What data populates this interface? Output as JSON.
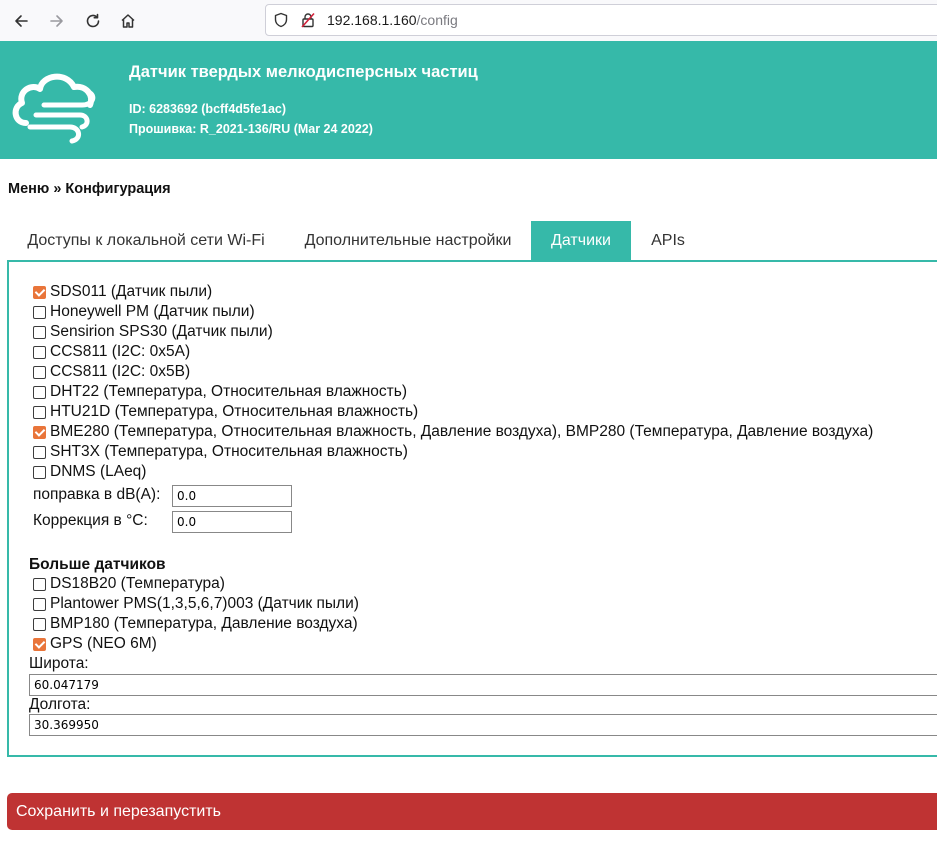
{
  "browser": {
    "url_host": "192.168.1.160",
    "url_path": "/config"
  },
  "header": {
    "title": "Датчик твердых мелкодисперсных частиц",
    "id_line": "ID: 6283692 (bcff4d5fe1ac)",
    "firmware_line": "Прошивка: R_2021-136/RU (Mar 24 2022)",
    "brand_color": "#36b9a9"
  },
  "breadcrumb": "Меню » Конфигурация",
  "tabs": [
    {
      "label": "Доступы к локальной сети Wi-Fi",
      "active": false
    },
    {
      "label": "Дополнительные настройки",
      "active": false
    },
    {
      "label": "Датчики",
      "active": true
    },
    {
      "label": "APIs",
      "active": false
    }
  ],
  "sensors": [
    {
      "label": "SDS011 (Датчик пыли)",
      "checked": true
    },
    {
      "label": "Honeywell PM (Датчик пыли)",
      "checked": false
    },
    {
      "label": "Sensirion SPS30 (Датчик пыли)",
      "checked": false
    },
    {
      "label": "CCS811 (I2C: 0x5A)",
      "checked": false
    },
    {
      "label": "CCS811 (I2C: 0x5B)",
      "checked": false
    },
    {
      "label": "DHT22 (Температура, Относительная влажность)",
      "checked": false
    },
    {
      "label": "HTU21D (Температура, Относительная влажность)",
      "checked": false
    },
    {
      "label": "BME280 (Температура, Относительная влажность, Давление воздуха), BMP280 (Температура, Давление воздуха)",
      "checked": true
    },
    {
      "label": "SHT3X (Температура, Относительная влажность)",
      "checked": false
    },
    {
      "label": "DNMS (LAeq)",
      "checked": false
    }
  ],
  "corrections": {
    "dba_label": "поправка в dB(A):",
    "dba_value": "0.0",
    "temp_label": "Коррекция в °C:",
    "temp_value": "0.0"
  },
  "more": {
    "title": "Больше датчиков",
    "items": [
      {
        "label": "DS18B20 (Температура)",
        "checked": false
      },
      {
        "label": "Plantower PMS(1,3,5,6,7)003 (Датчик пыли)",
        "checked": false
      },
      {
        "label": "BMP180 (Температура, Давление воздуха)",
        "checked": false
      },
      {
        "label": "GPS (NEO 6M)",
        "checked": true
      }
    ]
  },
  "location": {
    "lat_label": "Широта:",
    "lat_value": "60.047179",
    "lon_label": "Долгота:",
    "lon_value": "30.369950"
  },
  "save_button": "Сохранить и перезапустить",
  "colors": {
    "checkbox_checked": "#e9753a",
    "save_button": "#bf3333"
  }
}
